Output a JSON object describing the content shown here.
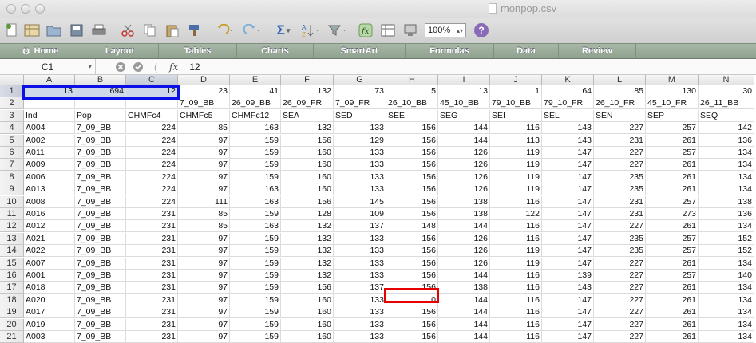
{
  "window": {
    "title": "monpop.csv"
  },
  "toolbar": {
    "zoom": "100%",
    "sum_symbol": "Σ",
    "help": "?"
  },
  "ribbon": {
    "tabs": [
      "Home",
      "Layout",
      "Tables",
      "Charts",
      "SmartArt",
      "Formulas",
      "Data",
      "Review"
    ]
  },
  "formula_bar": {
    "name_box": "C1",
    "fx": "fx",
    "value": "12"
  },
  "columns": [
    "A",
    "B",
    "C",
    "D",
    "E",
    "F",
    "G",
    "H",
    "I",
    "J",
    "K",
    "L",
    "M",
    "N"
  ],
  "rows": [
    {
      "n": "1",
      "cells": [
        "13",
        "694",
        "12",
        "23",
        "41",
        "132",
        "73",
        "5",
        "13",
        "1",
        "64",
        "85",
        "130",
        "30"
      ]
    },
    {
      "n": "2",
      "cells": [
        "",
        "",
        "",
        "7_09_BB",
        "26_09_BB",
        "26_09_FR",
        "7_09_FR",
        "26_10_BB",
        "45_10_BB",
        "79_10_BB",
        "79_10_FR",
        "26_10_FR",
        "45_10_FR",
        "26_11_BB"
      ]
    },
    {
      "n": "3",
      "cells": [
        "Ind",
        "Pop",
        "CHMFc4",
        "CHMFc5",
        "CHMFc12",
        "SEA",
        "SED",
        "SEE",
        "SEG",
        "SEI",
        "SEL",
        "SEN",
        "SEP",
        "SEQ"
      ]
    },
    {
      "n": "4",
      "cells": [
        "A004",
        "7_09_BB",
        "224",
        "85",
        "163",
        "132",
        "133",
        "156",
        "144",
        "116",
        "143",
        "227",
        "257",
        "142"
      ]
    },
    {
      "n": "5",
      "cells": [
        "A002",
        "7_09_BB",
        "224",
        "97",
        "159",
        "156",
        "129",
        "156",
        "144",
        "113",
        "143",
        "231",
        "261",
        "136"
      ]
    },
    {
      "n": "6",
      "cells": [
        "A011",
        "7_09_BB",
        "224",
        "97",
        "159",
        "160",
        "133",
        "156",
        "126",
        "119",
        "147",
        "227",
        "257",
        "134"
      ]
    },
    {
      "n": "7",
      "cells": [
        "A009",
        "7_09_BB",
        "224",
        "97",
        "159",
        "160",
        "133",
        "156",
        "126",
        "119",
        "147",
        "227",
        "261",
        "134"
      ]
    },
    {
      "n": "8",
      "cells": [
        "A006",
        "7_09_BB",
        "224",
        "97",
        "159",
        "160",
        "133",
        "156",
        "126",
        "119",
        "147",
        "235",
        "261",
        "134"
      ]
    },
    {
      "n": "9",
      "cells": [
        "A013",
        "7_09_BB",
        "224",
        "97",
        "163",
        "160",
        "133",
        "156",
        "126",
        "119",
        "147",
        "235",
        "261",
        "134"
      ]
    },
    {
      "n": "10",
      "cells": [
        "A008",
        "7_09_BB",
        "224",
        "111",
        "163",
        "156",
        "145",
        "156",
        "138",
        "116",
        "147",
        "231",
        "257",
        "138"
      ]
    },
    {
      "n": "11",
      "cells": [
        "A016",
        "7_09_BB",
        "231",
        "85",
        "159",
        "128",
        "109",
        "156",
        "138",
        "122",
        "147",
        "231",
        "273",
        "136"
      ]
    },
    {
      "n": "12",
      "cells": [
        "A012",
        "7_09_BB",
        "231",
        "85",
        "163",
        "132",
        "137",
        "148",
        "144",
        "116",
        "147",
        "227",
        "261",
        "134"
      ]
    },
    {
      "n": "13",
      "cells": [
        "A021",
        "7_09_BB",
        "231",
        "97",
        "159",
        "132",
        "133",
        "156",
        "126",
        "116",
        "147",
        "235",
        "257",
        "152"
      ]
    },
    {
      "n": "14",
      "cells": [
        "A022",
        "7_09_BB",
        "231",
        "97",
        "159",
        "132",
        "133",
        "156",
        "126",
        "119",
        "147",
        "235",
        "257",
        "152"
      ]
    },
    {
      "n": "15",
      "cells": [
        "A007",
        "7_09_BB",
        "231",
        "97",
        "159",
        "132",
        "133",
        "156",
        "126",
        "119",
        "147",
        "227",
        "261",
        "134"
      ]
    },
    {
      "n": "16",
      "cells": [
        "A001",
        "7_09_BB",
        "231",
        "97",
        "159",
        "132",
        "133",
        "156",
        "144",
        "116",
        "139",
        "227",
        "257",
        "140"
      ]
    },
    {
      "n": "17",
      "cells": [
        "A018",
        "7_09_BB",
        "231",
        "97",
        "159",
        "156",
        "137",
        "156",
        "138",
        "116",
        "143",
        "227",
        "261",
        "134"
      ]
    },
    {
      "n": "18",
      "cells": [
        "A020",
        "7_09_BB",
        "231",
        "97",
        "159",
        "160",
        "133",
        "0",
        "144",
        "116",
        "147",
        "227",
        "261",
        "134"
      ]
    },
    {
      "n": "19",
      "cells": [
        "A017",
        "7_09_BB",
        "231",
        "97",
        "159",
        "160",
        "133",
        "156",
        "144",
        "116",
        "147",
        "227",
        "261",
        "134"
      ]
    },
    {
      "n": "20",
      "cells": [
        "A019",
        "7_09_BB",
        "231",
        "97",
        "159",
        "160",
        "133",
        "156",
        "144",
        "116",
        "147",
        "227",
        "261",
        "134"
      ]
    },
    {
      "n": "21",
      "cells": [
        "A003",
        "7_09_BB",
        "231",
        "97",
        "159",
        "160",
        "133",
        "156",
        "144",
        "116",
        "147",
        "227",
        "261",
        "134"
      ]
    }
  ],
  "colors": {
    "highlight_blue": "#0a10e6",
    "highlight_red": "#e60000",
    "ribbon": "#98a997"
  }
}
